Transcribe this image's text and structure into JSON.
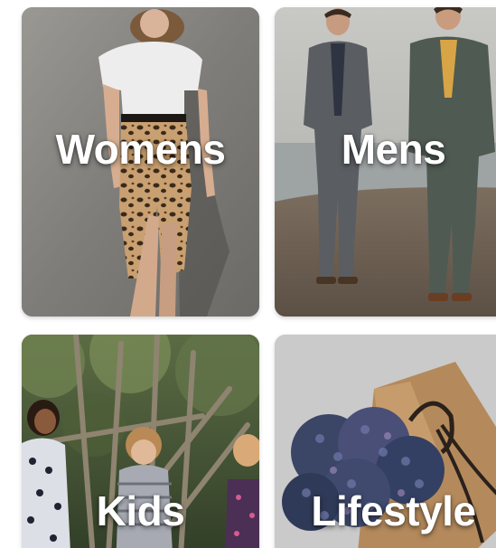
{
  "categories": [
    {
      "label": "Womens"
    },
    {
      "label": "Mens"
    },
    {
      "label": "Kids"
    },
    {
      "label": "Lifestyle"
    }
  ],
  "colors": {
    "label_text": "#ffffff",
    "background": "#ffffff"
  }
}
